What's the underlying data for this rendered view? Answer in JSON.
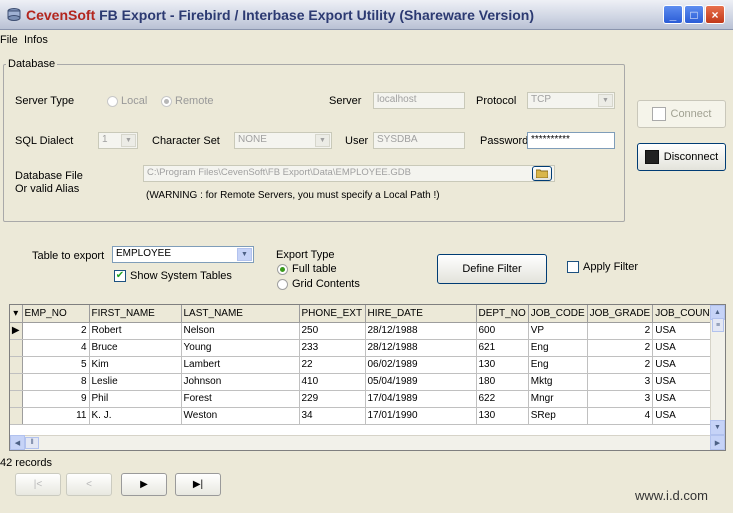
{
  "window": {
    "title_brand": "CevenSoft",
    "title_rest": "FB Export - Firebird / Interbase Export Utility (Shareware Version)",
    "minimize_icon": "_",
    "maximize_icon": "□",
    "close_icon": "×"
  },
  "menu": [
    "File",
    "Infos"
  ],
  "database": {
    "group_label": "Database",
    "server_type_label": "Server Type",
    "local_label": "Local",
    "remote_label": "Remote",
    "server_type_selected": "Remote",
    "server_label": "Server",
    "server_value": "localhost",
    "protocol_label": "Protocol",
    "protocol_value": "TCP",
    "sql_dialect_label": "SQL Dialect",
    "sql_dialect_value": "1",
    "charset_label": "Character Set",
    "charset_value": "NONE",
    "user_label": "User",
    "user_value": "SYSDBA",
    "password_label": "Password",
    "password_value": "**********",
    "file_label_line1": "Database File",
    "file_label_line2": "Or valid Alias",
    "file_value": "C:\\Program Files\\CevenSoft\\FB Export\\Data\\EMPLOYEE.GDB",
    "warning": "(WARNING : for Remote Servers, you must specify a Local Path !)",
    "connect_label": "Connect",
    "disconnect_label": "Disconnect"
  },
  "export": {
    "table_label": "Table to export",
    "table_value": "EMPLOYEE",
    "show_system_label": "Show System Tables",
    "show_system_checked": true,
    "export_type_label": "Export Type",
    "full_table_label": "Full table",
    "grid_contents_label": "Grid Contents",
    "export_type_selected": "Full table",
    "define_filter_label": "Define Filter",
    "apply_filter_label": "Apply Filter",
    "apply_filter_checked": false
  },
  "grid": {
    "columns": [
      "EMP_NO",
      "FIRST_NAME",
      "LAST_NAME",
      "PHONE_EXT",
      "HIRE_DATE",
      "DEPT_NO",
      "JOB_CODE",
      "JOB_GRADE",
      "JOB_COUN"
    ],
    "rows": [
      [
        "2",
        "Robert",
        "Nelson",
        "250",
        "28/12/1988",
        "600",
        "VP",
        "2",
        "USA"
      ],
      [
        "4",
        "Bruce",
        "Young",
        "233",
        "28/12/1988",
        "621",
        "Eng",
        "2",
        "USA"
      ],
      [
        "5",
        "Kim",
        "Lambert",
        "22",
        "06/02/1989",
        "130",
        "Eng",
        "2",
        "USA"
      ],
      [
        "8",
        "Leslie",
        "Johnson",
        "410",
        "05/04/1989",
        "180",
        "Mktg",
        "3",
        "USA"
      ],
      [
        "9",
        "Phil",
        "Forest",
        "229",
        "17/04/1989",
        "622",
        "Mngr",
        "3",
        "USA"
      ],
      [
        "11",
        "K. J.",
        "Weston",
        "34",
        "17/01/1990",
        "130",
        "SRep",
        "4",
        "USA"
      ]
    ],
    "current_row_marker": "▶"
  },
  "status": {
    "records": "42 records"
  },
  "nav": {
    "first": "|<",
    "prev": "<",
    "next": "▶",
    "last": "▶|"
  },
  "watermark": "www.i.d.com"
}
